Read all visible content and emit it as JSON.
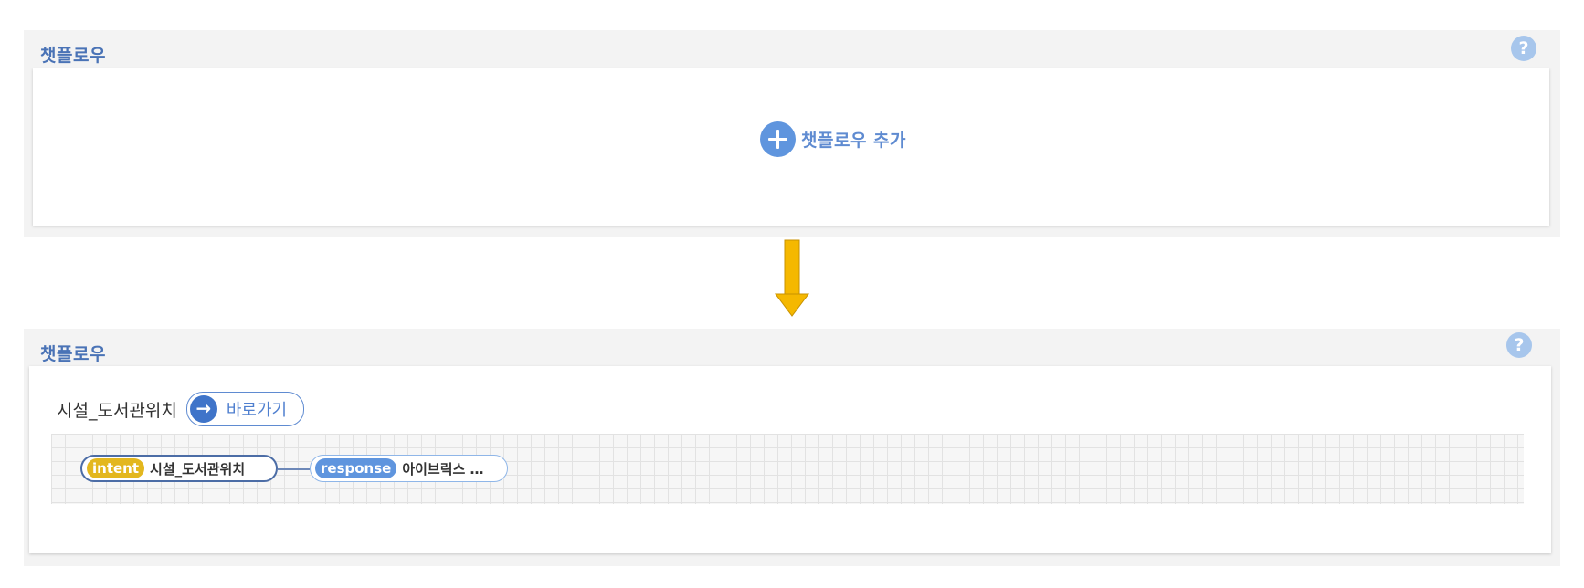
{
  "top_panel": {
    "title": "챗플로우",
    "help_label": "?",
    "add_button_label": "챗플로우 추가"
  },
  "bottom_panel": {
    "title": "챗플로우",
    "help_label": "?",
    "flow_name": "시설_도서관위치",
    "goto_icon": "→",
    "goto_label": "바로가기",
    "intent_node": {
      "tag": "intent",
      "text": "시설_도서관위치"
    },
    "response_node": {
      "tag": "response",
      "text": "아이브릭스 …"
    }
  },
  "colors": {
    "title_blue": "#4a73b6",
    "accent_blue": "#5f95de",
    "intent_yellow": "#e3b71e",
    "arrow_yellow": "#f5b800",
    "panel_bg": "#f3f3f3"
  },
  "icons": [
    "help-icon",
    "plus-icon",
    "arrow-right-icon",
    "arrow-down-icon"
  ]
}
